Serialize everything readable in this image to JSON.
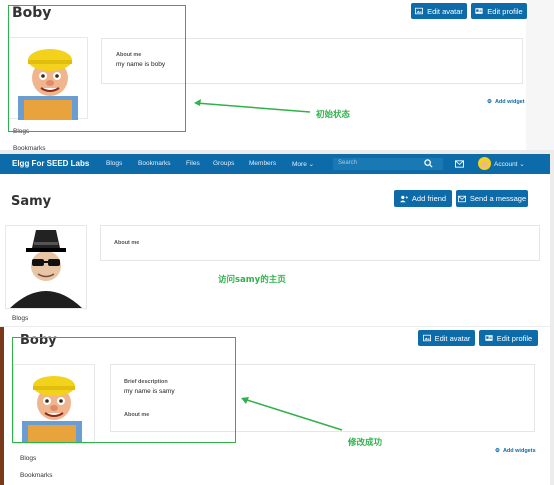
{
  "top": {
    "username": "Boby",
    "edit_avatar": "Edit avatar",
    "edit_profile": "Edit profile",
    "about_label": "About me",
    "about_text": "my name is boby",
    "blogs": "Blogs",
    "bookmarks": "Bookmarks",
    "add_widgets": "Add widget",
    "annotation": "初始状态"
  },
  "nav": {
    "brand": "Elgg For SEED Labs",
    "items": [
      "Blogs",
      "Bookmarks",
      "Files",
      "Groups",
      "Members",
      "More ⌄"
    ],
    "search_placeholder": "Search",
    "account": "Account ⌄"
  },
  "middle": {
    "username": "Samy",
    "add_friend": "Add friend",
    "send_message": "Send a message",
    "about_label": "About me",
    "blogs": "Blogs",
    "annotation": "访问samy的主页"
  },
  "bottom": {
    "username": "Boby",
    "edit_avatar": "Edit avatar",
    "edit_profile": "Edit profile",
    "brief_label": "Brief description",
    "brief_text": "my name is samy",
    "about_label": "About me",
    "blogs": "Blogs",
    "bookmarks": "Bookmarks",
    "add_widgets": "Add widgets",
    "annotation": "修改成功"
  },
  "colors": {
    "accent": "#0c6ba8",
    "annotation": "#2fb24a"
  }
}
